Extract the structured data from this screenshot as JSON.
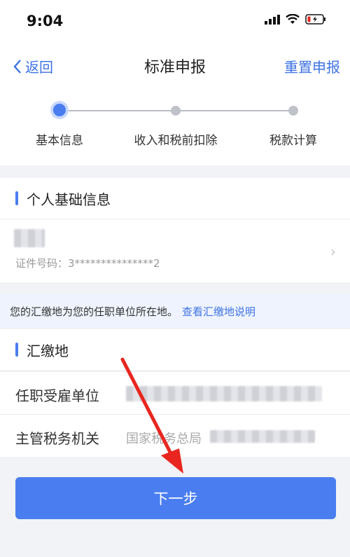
{
  "status_bar": {
    "time": "9:04"
  },
  "nav": {
    "back_label": "返回",
    "title": "标准申报",
    "reset_label": "重置申报"
  },
  "steps": [
    {
      "label": "基本信息",
      "active": true
    },
    {
      "label": "收入和税前扣除",
      "active": false
    },
    {
      "label": "税款计算",
      "active": false
    }
  ],
  "personal_section": {
    "title": "个人基础信息",
    "id_label": "证件号码：3***************2"
  },
  "notice": {
    "text": "您的汇缴地为您的任职单位所在地。",
    "link": "查看汇缴地说明"
  },
  "region_section": {
    "title": "汇缴地",
    "rows": [
      {
        "label": "任职受雇单位",
        "value": ""
      },
      {
        "label": "主管税务机关",
        "value": "国家税务总局"
      }
    ]
  },
  "next_button": "下一步",
  "colors": {
    "accent": "#4a7ef0",
    "annotation_arrow": "#e8261f"
  }
}
